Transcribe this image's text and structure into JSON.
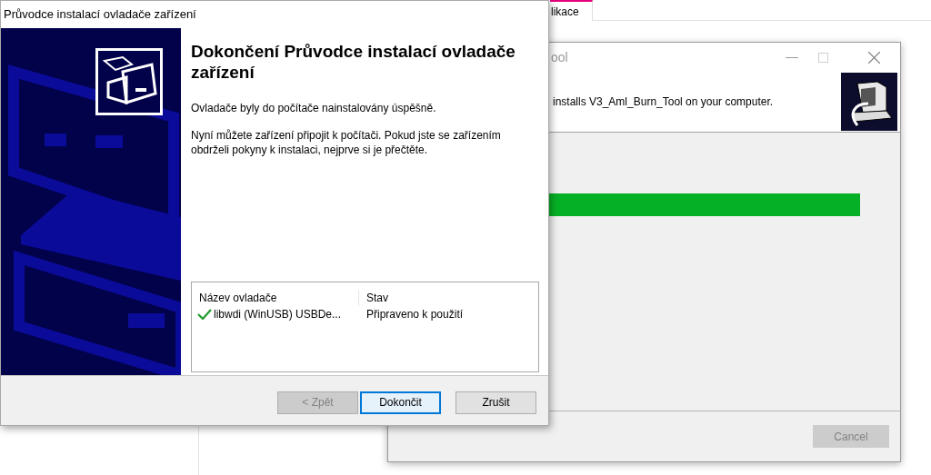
{
  "background_tab": {
    "label": "likace"
  },
  "installer_window": {
    "title": "ool",
    "header_text": "installs V3_Aml_Burn_Tool on your computer.",
    "progress": {
      "level": 1
    },
    "buttons": [
      {
        "label": "Cancel",
        "disabled": true
      }
    ]
  },
  "wizard": {
    "title": "Průvodce instalací ovladače zařízení",
    "heading": "Dokončení Průvodce instalací ovladače zařízení",
    "messages": [
      "Ovladače byly do počítače nainstalovány úspěšně.",
      "Nyní můžete zařízení připojit k počítači. Pokud jste se zařízením obdrželi pokyny k instalaci, nejprve si je přečtěte."
    ],
    "driver_table": {
      "columns": [
        "Název ovladače",
        "Stav"
      ],
      "rows": [
        {
          "kind": "ok",
          "cells": [
            "libwdi (WinUSB) USBDe...",
            "Připraveno k použití"
          ]
        }
      ]
    },
    "buttons": [
      {
        "label": "< Zpět",
        "disabled": true,
        "default": false
      },
      {
        "label": "Dokončit",
        "disabled": false,
        "default": true
      },
      {
        "label": "Zrušit",
        "disabled": false,
        "default": false
      }
    ]
  }
}
